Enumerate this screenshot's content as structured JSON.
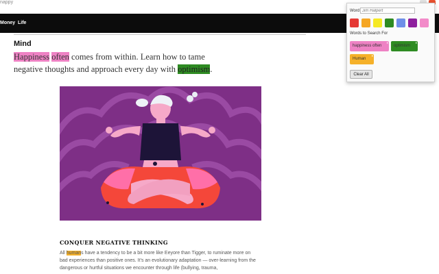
{
  "browser": {
    "tab_title_stub": "nappy"
  },
  "nav": {
    "items": [
      "Money",
      "Life"
    ]
  },
  "article": {
    "section": "Mind",
    "lead": {
      "part1": "Happiness",
      "part2": " ",
      "part3": "often",
      "part4": " comes from within. Learn how to tame negative thoughts and approach every day with ",
      "part5": "optimism",
      "part6": "."
    },
    "subheading": "CONQUER NEGATIVE THINKING",
    "body": {
      "part1": "All ",
      "part2": "human",
      "part3": "s have a tendency to be a bit more like Eeyore than Tigger, to ruminate more on bad experiences than positive ones. It’s an evolutionary adaptation — over-learning from the dangerous or hurtful situations we encounter through life (bullying, trauma,"
    }
  },
  "popup": {
    "word_label": "Word",
    "word_placeholder": "Jim Halpert",
    "colors": [
      "#e53935",
      "#f5a623",
      "#f5e923",
      "#2e8b22",
      "#6f8fe8",
      "#8e1f9e",
      "#f28bc9"
    ],
    "list_label": "Words to Search For",
    "chips": [
      {
        "label": "happiness often",
        "color": "#ee82c4"
      },
      {
        "label": "optimism",
        "color": "#2e8b22"
      },
      {
        "label": "Human",
        "color": "#f5b12a"
      }
    ],
    "clear_label": "Clear All"
  }
}
